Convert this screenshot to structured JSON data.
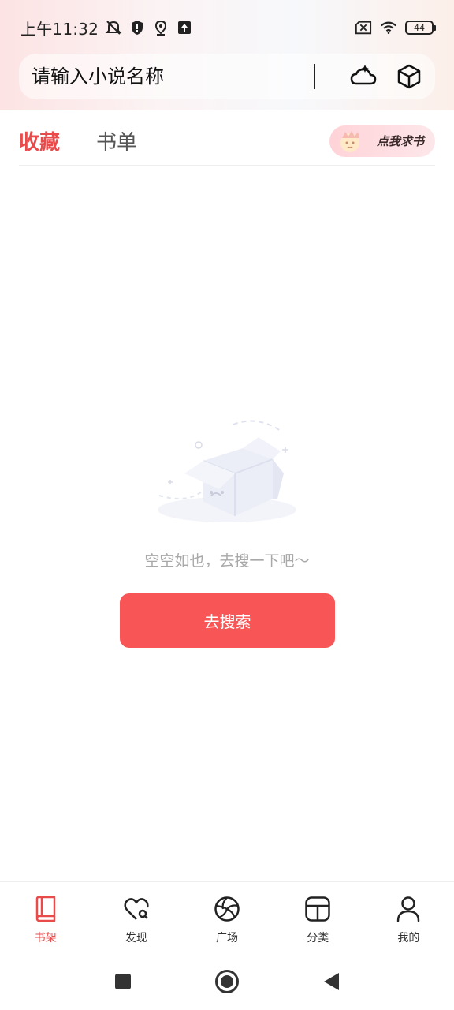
{
  "status_bar": {
    "time": "上午11:32",
    "battery": "44"
  },
  "search": {
    "placeholder": "请输入小说名称"
  },
  "tabs": [
    {
      "label": "收藏",
      "active": true
    },
    {
      "label": "书单",
      "active": false
    }
  ],
  "request_book_label": "点我求书",
  "empty_state": {
    "message": "空空如也，去搜一下吧～",
    "button_label": "去搜索"
  },
  "bottom_nav": [
    {
      "label": "书架",
      "icon": "book-icon",
      "active": true
    },
    {
      "label": "发现",
      "icon": "heart-search-icon",
      "active": false
    },
    {
      "label": "广场",
      "icon": "aperture-icon",
      "active": false
    },
    {
      "label": "分类",
      "icon": "category-icon",
      "active": false
    },
    {
      "label": "我的",
      "icon": "person-icon",
      "active": false
    }
  ],
  "colors": {
    "accent": "#e94b4b",
    "button": "#f85656"
  }
}
